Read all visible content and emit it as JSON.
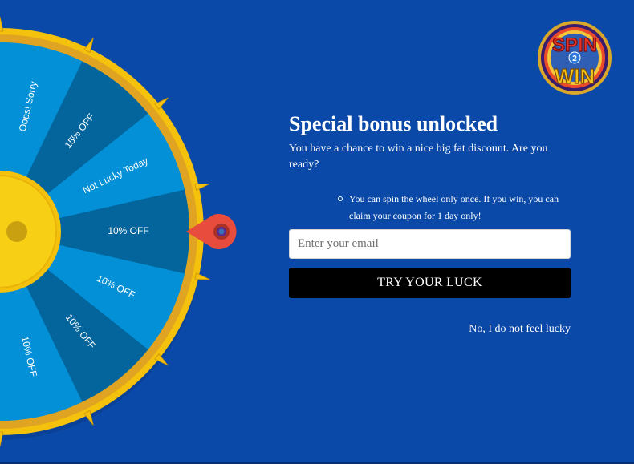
{
  "wheel": {
    "slices": [
      {
        "label": "Oops! Sorry",
        "color": "#0390d6"
      },
      {
        "label": "15% OFF",
        "color": "#03659c"
      },
      {
        "label": "Not Lucky Today",
        "color": "#0390d6"
      },
      {
        "label": "10% OFF",
        "color": "#03659c"
      },
      {
        "label": "10% OFF",
        "color": "#0390d6"
      },
      {
        "label": "10% OFF",
        "color": "#03659c"
      },
      {
        "label": "10% OFF",
        "color": "#0390d6"
      }
    ],
    "rim_color": "#f4c20d",
    "hub_color": "#f4c20d",
    "pointer_color": "#e74c3c",
    "pointer_icon": "map-pin-pointer-icon"
  },
  "logo": {
    "text_top": "SPIN",
    "text_mid": "2",
    "text_bottom": "WIN",
    "icon": "spin-to-win-logo"
  },
  "popup": {
    "title": "Special bonus unlocked",
    "subtitle": "You have a chance to win a nice big fat discount. Are you ready?",
    "rules": [
      "You can spin the wheel only once. If you win, you can claim your coupon for 1 day only!"
    ],
    "email_placeholder": "Enter your email",
    "email_value": "",
    "button_label": "TRY YOUR LUCK",
    "decline_link": "No, I do not feel lucky"
  },
  "colors": {
    "background": "#0a49a8",
    "button": "#000000",
    "text": "#ffffff"
  }
}
